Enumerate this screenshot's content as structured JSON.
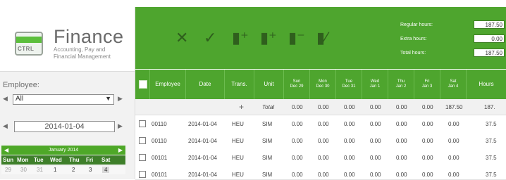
{
  "logo": {
    "badge": "CTRL",
    "title": "Finance",
    "subtitle_line1": "Accounting, Pay and",
    "subtitle_line2": "Financial Management"
  },
  "sidebar": {
    "employee_label": "Employee:",
    "employee_selected": "All",
    "date_value": "2014-01-04",
    "calendar": {
      "month_label": "January 2014",
      "weekdays": [
        "Sun",
        "Mon",
        "Tue",
        "Wed",
        "Thu",
        "Fri",
        "Sat"
      ],
      "days": [
        "29",
        "30",
        "31",
        "1",
        "2",
        "3",
        "4"
      ]
    }
  },
  "toolbar": {
    "icons": [
      "close-icon",
      "check-icon",
      "add-doc-icon",
      "copy-doc-icon",
      "remove-doc-icon",
      "edit-doc-icon"
    ],
    "regular_hours_label": "Regular hours:",
    "regular_hours_value": "187.50",
    "extra_hours_label": "Extra hours:",
    "extra_hours_value": "0.00",
    "total_hours_label": "Total hours:",
    "total_hours_value": "187.50"
  },
  "table": {
    "headers": {
      "employee": "Employee",
      "date": "Date",
      "trans": "Trans.",
      "unit": "Unit",
      "sun": "Sun",
      "sun_d": "Dec 29",
      "mon": "Mon",
      "mon_d": "Dec 30",
      "tue": "Tue",
      "tue_d": "Dec 31",
      "wed": "Wed",
      "wed_d": "Jan 1",
      "thu": "Thu",
      "thu_d": "Jan 2",
      "fri": "Fri",
      "fri_d": "Jan 3",
      "sat": "Sat",
      "sat_d": "Jan 4",
      "hours": "Hours"
    },
    "total": {
      "label": "Total",
      "plus": "+",
      "values": [
        "0.00",
        "0.00",
        "0.00",
        "0.00",
        "0.00",
        "0.00",
        "187.50",
        "187."
      ]
    },
    "rows": [
      {
        "employee": "00110",
        "date": "2014-01-04",
        "trans": "HEU",
        "unit": "SIM",
        "values": [
          "0.00",
          "0.00",
          "0.00",
          "0.00",
          "0.00",
          "0.00",
          "0.00",
          "37.5"
        ]
      },
      {
        "employee": "00110",
        "date": "2014-01-04",
        "trans": "HEU",
        "unit": "SIM",
        "values": [
          "0.00",
          "0.00",
          "0.00",
          "0.00",
          "0.00",
          "0.00",
          "0.00",
          "37.5"
        ]
      },
      {
        "employee": "00101",
        "date": "2014-01-04",
        "trans": "HEU",
        "unit": "SIM",
        "values": [
          "0.00",
          "0.00",
          "0.00",
          "0.00",
          "0.00",
          "0.00",
          "0.00",
          "37.5"
        ]
      },
      {
        "employee": "00101",
        "date": "2014-01-04",
        "trans": "HEU",
        "unit": "SIM",
        "values": [
          "0.00",
          "0.00",
          "0.00",
          "0.00",
          "0.00",
          "0.00",
          "0.00",
          "37.5"
        ]
      }
    ]
  },
  "colors": {
    "accent": "#4ea52e",
    "dark_accent": "#3e7f2a",
    "icon": "#2f5f1d"
  }
}
